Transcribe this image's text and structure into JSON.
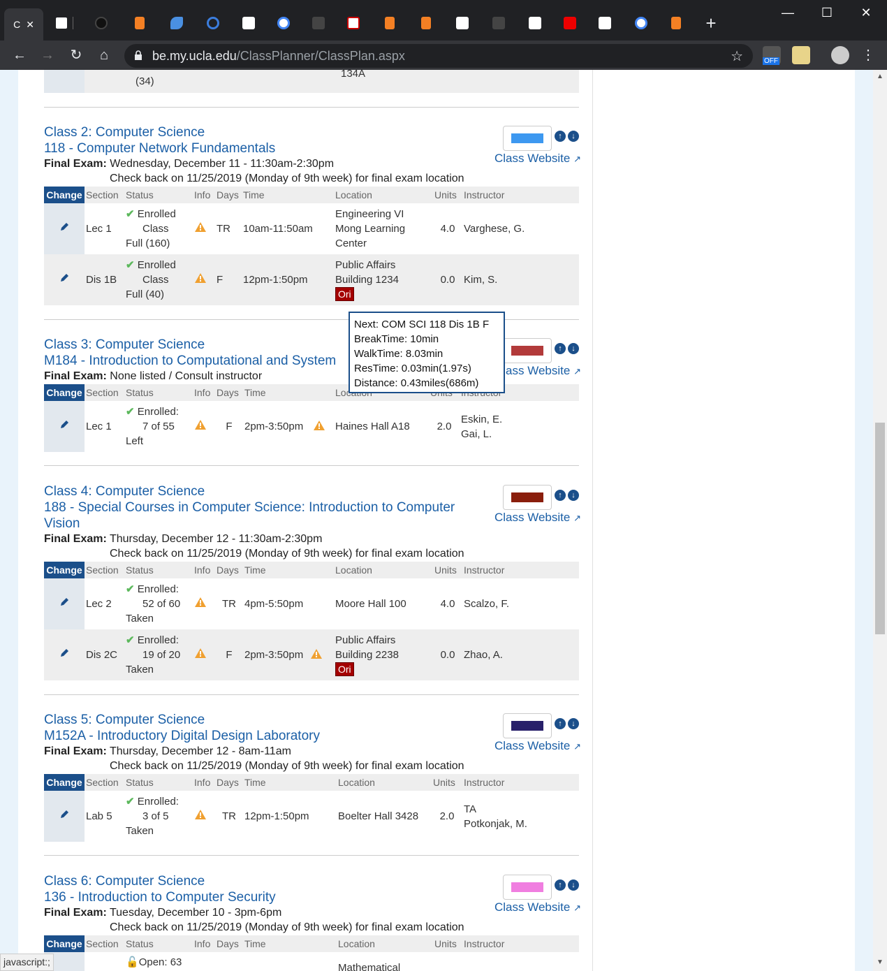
{
  "browser": {
    "active_tab_label": "C",
    "url_host": "be.my.ucla.edu",
    "url_path": "/ClassPlanner/ClassPlan.aspx",
    "ext_badge": "OFF"
  },
  "top_partial": {
    "status": "(34)",
    "location": "134A"
  },
  "table_headers": {
    "change": "Change",
    "section": "Section",
    "status": "Status",
    "info": "Info",
    "days": "Days",
    "time": "Time",
    "location": "Location",
    "units": "Units",
    "instructor": "Instructor"
  },
  "website_label": "Class Website",
  "classes": [
    {
      "heading": "Class 2: Computer Science",
      "course": "118 - Computer Network Fundamentals",
      "final_label": "Final Exam:",
      "final_value": "Wednesday, December 11 - 11:30am-2:30pm",
      "note": "Check back on 11/25/2019 (Monday of 9th week) for final exam location",
      "color": "#3d98f0",
      "rows": [
        {
          "section": "Lec 1",
          "status1": "Enrolled",
          "status2": "Class",
          "status3": "Full (160)",
          "days": "TR",
          "time": "10am-11:50am",
          "loc1": "Engineering VI",
          "loc2": "Mong Learning",
          "loc3": "Center",
          "units": "4.0",
          "instructor1": "Varghese, G.",
          "instructor2": ""
        },
        {
          "section": "Dis 1B",
          "status1": "Enrolled",
          "status2": "Class",
          "status3": "Full (40)",
          "days": "F",
          "time": "12pm-1:50pm",
          "loc1": "Public Affairs",
          "loc2": "Building 1234",
          "loc3": "Ori",
          "units": "0.0",
          "instructor1": "Kim, S.",
          "instructor2": ""
        }
      ]
    },
    {
      "heading": "Class 3: Computer Science",
      "course": "M184 - Introduction to Computational and System",
      "final_label": "Final Exam:",
      "final_value": "None listed / Consult instructor",
      "color": "#b23a3a",
      "rows": [
        {
          "section": "Lec 1",
          "status1": "Enrolled:",
          "status2": "7 of 55",
          "status3": "Left",
          "days": "F",
          "time": "2pm-3:50pm",
          "loc1": "Haines Hall A18",
          "units": "2.0",
          "instructor1": "Eskin, E.",
          "instructor2": "Gai, L."
        }
      ]
    },
    {
      "heading": "Class 4: Computer Science",
      "course": "188 - Special Courses in Computer Science: Introduction to Computer",
      "course_line2": "Vision",
      "final_label": "Final Exam:",
      "final_value": "Thursday, December 12 - 11:30am-2:30pm",
      "note": "Check back on 11/25/2019 (Monday of 9th week) for final exam location",
      "color": "#8a1e0c",
      "rows": [
        {
          "section": "Lec 2",
          "status1": "Enrolled:",
          "status2": "52 of 60",
          "status3": "Taken",
          "days": "TR",
          "time": "4pm-5:50pm",
          "loc1": "Moore Hall 100",
          "units": "4.0",
          "instructor1": "Scalzo, F."
        },
        {
          "section": "Dis 2C",
          "status1": "Enrolled:",
          "status2": "19 of 20",
          "status3": "Taken",
          "days": "F",
          "time": "2pm-3:50pm",
          "loc1": "Public Affairs",
          "loc2": "Building 2238",
          "loc3": "Ori",
          "units": "0.0",
          "instructor1": "Zhao, A."
        }
      ]
    },
    {
      "heading": "Class 5: Computer Science",
      "course": "M152A - Introductory Digital Design Laboratory",
      "final_label": "Final Exam:",
      "final_value": "Thursday, December 12 - 8am-11am",
      "note": "Check back on 11/25/2019 (Monday of 9th week) for final exam location",
      "color": "#28206a",
      "rows": [
        {
          "section": "Lab 5",
          "status1": "Enrolled:",
          "status2": "3 of 5",
          "status3": "Taken",
          "days": "TR",
          "time": "12pm-1:50pm",
          "loc1": "Boelter Hall 3428",
          "units": "2.0",
          "instructor1": "TA",
          "instructor2": "Potkonjak, M."
        }
      ]
    },
    {
      "heading": "Class 6: Computer Science",
      "course": "136 - Introduction to Computer Security",
      "final_label": "Final Exam:",
      "final_value": "Tuesday, December 10 - 3pm-6pm",
      "note": "Check back on 11/25/2019 (Monday of 9th week) for final exam location",
      "color": "#f07ee0",
      "rows": [
        {
          "status1": "Open: 63",
          "loc1": "Mathematical"
        }
      ]
    }
  ],
  "tooltip": {
    "line1": "Next: COM SCI 118 Dis 1B F",
    "line2": "BreakTime: 10min",
    "line3": "WalkTime: 8.03min",
    "line4": "ResTime: 0.03min(1.97s)",
    "line5": "Distance: 0.43miles(686m)"
  },
  "statusbar": "javascript:;"
}
